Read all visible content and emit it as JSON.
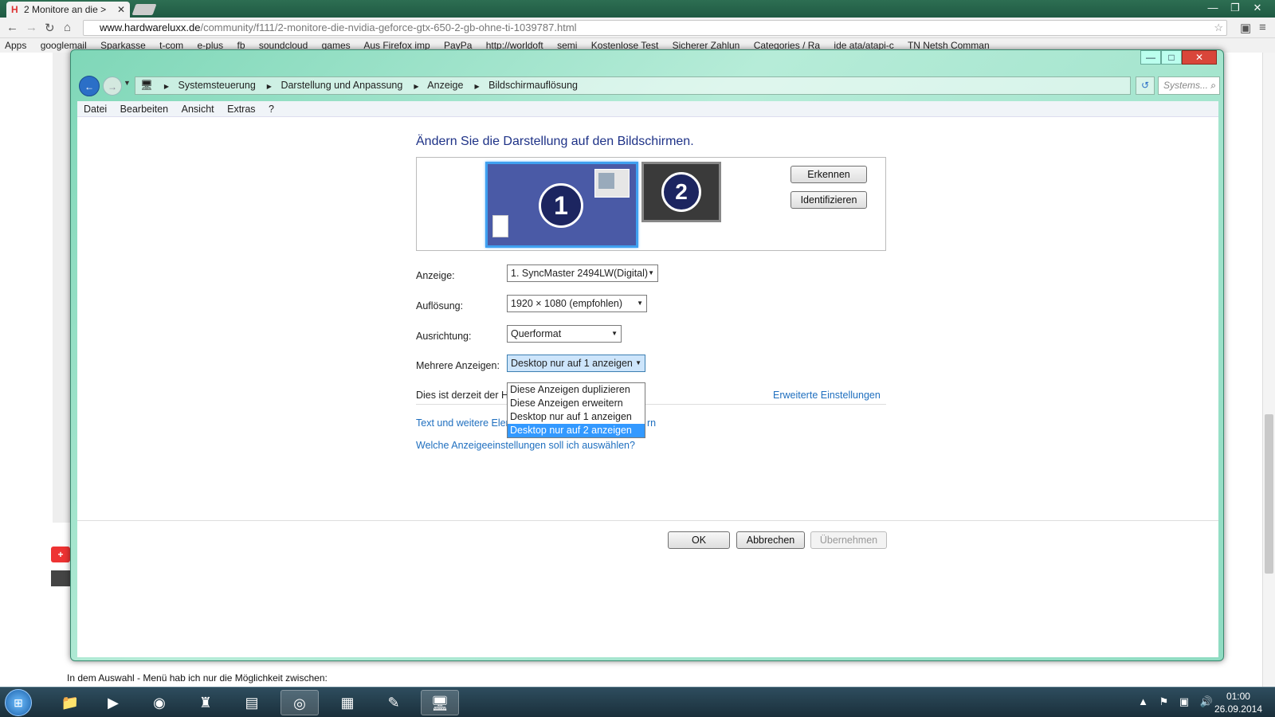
{
  "browser": {
    "tab_title": "2 Monitore an die >",
    "tab_favicon": "H",
    "url_host": "www.hardwareluxx.de",
    "url_path": "/community/f111/2-monitore-die-nvidia-geforce-gtx-650-2-gb-ohne-ti-1039787.html",
    "bookmarks": [
      "Apps",
      "googlemail",
      "Sparkasse",
      "t-com",
      "e-plus",
      "fb",
      "soundcloud",
      "games",
      "Aus Firefox imp",
      "PayPa",
      "http://worldoft",
      "semi",
      "Kostenlose Test",
      "Sicherer Zahlun",
      "Categories / Ra",
      "ide ata/atapi-c",
      "TN Netsh Comman"
    ]
  },
  "background_page": {
    "bottom_text": "In dem Auswahl - Menü hab ich nur die Möglichkeit zwischen:"
  },
  "window": {
    "breadcrumb": [
      "Systemsteuerung",
      "Darstellung und Anpassung",
      "Anzeige",
      "Bildschirmauflösung"
    ],
    "search_placeholder": "Systems...",
    "menu": [
      "Datei",
      "Bearbeiten",
      "Ansicht",
      "Extras",
      "?"
    ],
    "heading": "Ändern Sie die Darstellung auf den Bildschirmen.",
    "monitor1": "1",
    "monitor2": "2",
    "btn_detect": "Erkennen",
    "btn_identify": "Identifizieren",
    "anzeige_label": "Anzeige:",
    "anzeige_value": "1. SyncMaster 2494LW(Digital)",
    "aufloesung_label": "Auflösung:",
    "aufloesung_value": "1920 × 1080 (empfohlen)",
    "ausrichtung_label": "Ausrichtung:",
    "ausrichtung_value": "Querformat",
    "mehrere_label": "Mehrere Anzeigen:",
    "mehrere_value": "Desktop nur auf 1 anzeigen",
    "mehrere_options": [
      "Diese Anzeigen duplizieren",
      "Diese Anzeigen erweitern",
      "Desktop nur auf 1 anzeigen",
      "Desktop nur auf 2 anzeigen"
    ],
    "info_text": "Dies ist derzeit der H",
    "advanced_link": "Erweiterte Einstellungen",
    "text_link_start": "Text und weitere Eler",
    "text_link_end": "rn",
    "help_link": "Welche Anzeigeeinstellungen soll ich auswählen?",
    "ok": "OK",
    "cancel": "Abbrechen",
    "apply": "Übernehmen"
  },
  "taskbar": {
    "time": "01:00",
    "date": "26.09.2014"
  }
}
